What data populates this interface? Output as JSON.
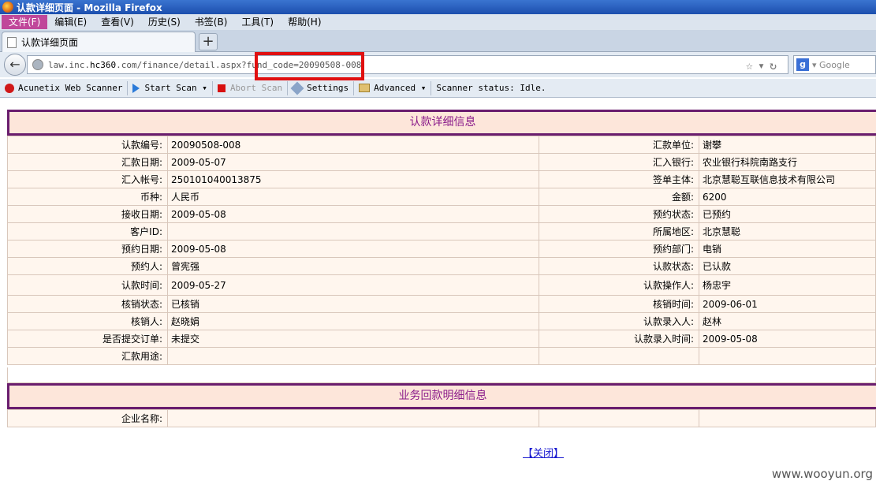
{
  "window": {
    "title": "认款详细页面 - Mozilla Firefox"
  },
  "menu": [
    "文件(F)",
    "编辑(E)",
    "查看(V)",
    "历史(S)",
    "书签(B)",
    "工具(T)",
    "帮助(H)"
  ],
  "tab": {
    "title": "认款详细页面",
    "new_tab": "+"
  },
  "url": {
    "host_prefix": "law.inc.",
    "host": "hc360",
    "host_suffix": ".com",
    "path": "/finance/detail.aspx?fund_code=20090508-008"
  },
  "search": {
    "engine": "g",
    "placeholder": "Google"
  },
  "toolbar": {
    "brand": "Acunetix Web Scanner",
    "start": "Start Scan",
    "abort": "Abort Scan",
    "settings": "Settings",
    "advanced": "Advanced",
    "status": "Scanner status: Idle."
  },
  "section1": "认款详细信息",
  "rows": [
    {
      "l1": "认款编号:",
      "v1": " 20090508-008",
      "l2": "汇款单位:",
      "v2": " 谢攀"
    },
    {
      "l1": "汇款日期:",
      "v1": "2009-05-07",
      "l2": "汇入银行:",
      "v2": "农业银行科院南路支行"
    },
    {
      "l1": "汇入帐号:",
      "v1": "250101040013875",
      "l2": "签单主体:",
      "v2": "北京慧聪互联信息技术有限公司"
    },
    {
      "l1": "币种:",
      "v1": "人民币",
      "l2": "金额:",
      "v2": "6200"
    },
    {
      "l1": "接收日期:",
      "v1": "2009-05-08",
      "l2": "预约状态:",
      "v2": "已预约"
    },
    {
      "l1": "客户ID:",
      "v1": "",
      "l2": "所属地区:",
      "v2": "北京慧聪"
    },
    {
      "l1": "预约日期:",
      "v1": "2009-05-08",
      "l2": "预约部门:",
      "v2": "电销"
    },
    {
      "l1": "预约人:",
      "v1": "曾宪强",
      "l2": "认款状态:",
      "v2": "已认款"
    },
    {
      "l1": "认款时间:",
      "v1": "2009-05-27",
      "l2": "认款操作人:",
      "v2": "杨忠宇"
    },
    {
      "l1": "核销状态:",
      "v1": "已核销",
      "l2": "核销时间:",
      "v2": "2009-06-01"
    },
    {
      "l1": "核销人:",
      "v1": "赵晓娟",
      "l2": "认款录入人:",
      "v2": "赵林"
    },
    {
      "l1": "是否提交订单:",
      "v1": "未提交",
      "l2": "认款录入时间:",
      "v2": "2009-05-08"
    },
    {
      "l1": "汇款用途:",
      "v1": "",
      "l2": "",
      "v2": ""
    }
  ],
  "section2": "业务回款明细信息",
  "company_label": "企业名称:",
  "close": "【关闭】",
  "watermark": "www.wooyun.org"
}
